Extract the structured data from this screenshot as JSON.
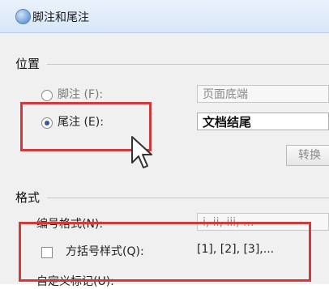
{
  "window": {
    "title": "脚注和尾注"
  },
  "location": {
    "section_label": "位置",
    "footnote": {
      "label": "脚注 (F):",
      "value": "页面底端",
      "selected": false
    },
    "endnote": {
      "label": "尾注 (E):",
      "value": "文档结尾",
      "selected": true
    },
    "convert_button": "转换"
  },
  "format": {
    "section_label": "格式",
    "number_format": {
      "label": "编号格式(N):",
      "value": "i, ii, iii, ..."
    },
    "bracket_style": {
      "label": "方括号样式(Q):",
      "preview": "[1], [2], [3],...",
      "checked": false
    },
    "custom_mark": {
      "label": "自定义标记(U):"
    }
  },
  "annotation_color": "#d23a3a",
  "title_icon": "app-circle-icon"
}
